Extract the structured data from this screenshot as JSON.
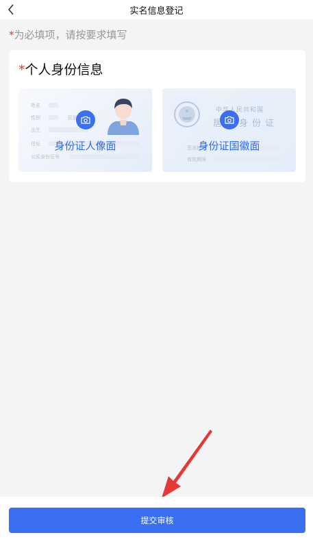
{
  "header": {
    "title": "实名信息登记",
    "back_icon": "chevron-left-icon"
  },
  "hint": {
    "star": "*",
    "text": "为必填项，请按要求填写"
  },
  "card": {
    "title_star": "*",
    "title": "个人身份信息",
    "front": {
      "label": "身份证人像面",
      "ghost_fields": [
        "姓名",
        "性别",
        "民族",
        "出生",
        "住址",
        "公民身份证号"
      ],
      "icon": "camera-icon"
    },
    "back": {
      "label": "身份证国徽面",
      "header_line1": "中华人民共和国",
      "header_line2": "居民身份证",
      "ghost_fields": [
        "签发机关",
        "有效期限"
      ],
      "icon": "camera-icon"
    }
  },
  "submit": {
    "label": "提交审核"
  },
  "colors": {
    "accent": "#3a6ff2",
    "required": "#e53935",
    "annotation_arrow": "#e53935"
  }
}
